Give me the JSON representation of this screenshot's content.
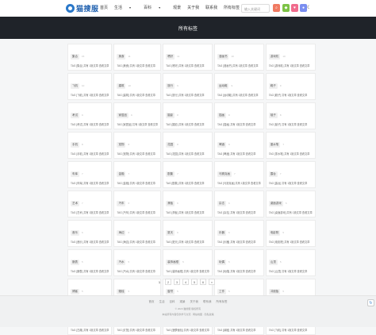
{
  "header": {
    "logo_text": "猫搜服",
    "nav": [
      "首页",
      "生活",
      "百科",
      "观景",
      "关于我",
      "联系我",
      "所有标签"
    ],
    "search_placeholder": "输入关键词",
    "search_icon": "search-icon",
    "moon_icon": "moon-icon"
  },
  "banner": {
    "title": "所有标签"
  },
  "tags": [
    {
      "name": "集合",
      "count": "15",
      "desc": "TAG [集合] 共有 1篇文章 查看文章"
    },
    {
      "name": "美食",
      "count": "11",
      "desc": "TAG [美食] 共有 1篇文章 查看文章"
    },
    {
      "name": "嗜好",
      "count": "11",
      "desc": "TAG [嗜好] 共有 1篇文章 查看文章"
    },
    {
      "name": "漫画书",
      "count": "10",
      "desc": "TAG [漫画书] 共有 1篇文章 查看文章"
    },
    {
      "name": "游戏机",
      "count": "10",
      "desc": "TAG [游戏机] 共有 1篇文章 查看文章"
    },
    {
      "name": "飞机",
      "count": "10",
      "desc": "TAG [飞机] 共有 1篇文章 查看文章"
    },
    {
      "name": "建筑",
      "count": "10",
      "desc": "TAG [建筑] 共有 1篇文章 查看文章"
    },
    {
      "name": "旅行",
      "count": "9",
      "desc": "TAG [旅行] 共有 1篇文章 查看文章"
    },
    {
      "name": "运动鞋",
      "count": "9",
      "desc": "TAG [运动鞋] 共有 1篇文章 查看文章"
    },
    {
      "name": "鞋子",
      "count": "9",
      "desc": "TAG [鞋子] 共有 1篇文章 查看文章"
    },
    {
      "name": "考试",
      "count": "9",
      "desc": "TAG [考试] 共有 1篇文章 查看文章"
    },
    {
      "name": "家居品",
      "count": "9",
      "desc": "TAG [家居品] 共有 1篇文章 查看文章"
    },
    {
      "name": "摄影",
      "count": "8",
      "desc": "TAG [摄影] 共有 1篇文章 查看文章"
    },
    {
      "name": "插画",
      "count": "8",
      "desc": "TAG [插画] 共有 1篇文章 查看文章"
    },
    {
      "name": "毯子",
      "count": "8",
      "desc": "TAG [毯子] 共有 1篇文章 查看文章"
    },
    {
      "name": "手机",
      "count": "8",
      "desc": "TAG [手机] 共有 1篇文章 查看文章"
    },
    {
      "name": "宠物",
      "count": "8",
      "desc": "TAG [宠物] 共有 1篇文章 查看文章"
    },
    {
      "name": "花园",
      "count": "8",
      "desc": "TAG [花园] 共有 1篇文章 查看文章"
    },
    {
      "name": "啤酒",
      "count": "8",
      "desc": "TAG [啤酒] 共有 1篇文章 查看文章"
    },
    {
      "name": "墨水笔",
      "count": "7",
      "desc": "TAG [墨水笔] 共有 1篇文章 查看文章"
    },
    {
      "name": "车库",
      "count": "7",
      "desc": "TAG [车库] 共有 1篇文章 查看文章"
    },
    {
      "name": "金融",
      "count": "7",
      "desc": "TAG [金融] 共有 1篇文章 查看文章"
    },
    {
      "name": "剧集",
      "count": "7",
      "desc": "TAG [剧集] 共有 1篇文章 查看文章"
    },
    {
      "name": "马赛克画",
      "count": "7",
      "desc": "TAG [马赛克画] 共有 1篇文章 查看文章"
    },
    {
      "name": "露台",
      "count": "7",
      "desc": "TAG [露台] 共有 1篇文章 查看文章"
    },
    {
      "name": "艺术",
      "count": "7",
      "desc": "TAG [艺术] 共有 1篇文章 查看文章"
    },
    {
      "name": "汽车",
      "count": "6",
      "desc": "TAG [汽车] 共有 1篇文章 查看文章"
    },
    {
      "name": "滑板",
      "count": "6",
      "desc": "TAG [滑板] 共有 1篇文章 查看文章"
    },
    {
      "name": "杂志",
      "count": "6",
      "desc": "TAG [杂志] 共有 1篇文章 查看文章"
    },
    {
      "name": "桌面游戏",
      "count": "6",
      "desc": "TAG [桌面游戏] 共有 1篇文章 查看文章"
    },
    {
      "name": "音乐",
      "count": "6",
      "desc": "TAG [音乐] 共有 1篇文章 查看文章"
    },
    {
      "name": "海边",
      "count": "6",
      "desc": "TAG [海边] 共有 1篇文章 查看文章"
    },
    {
      "name": "夏天",
      "count": "6",
      "desc": "TAG [夏天] 共有 1篇文章 查看文章"
    },
    {
      "name": "乐器",
      "count": "6",
      "desc": "TAG [乐器] 共有 1篇文章 查看文章"
    },
    {
      "name": "电影院",
      "count": "5",
      "desc": "TAG [电影院] 共有 1篇文章 查看文章"
    },
    {
      "name": "腕表",
      "count": "5",
      "desc": "TAG [腕表] 共有 1篇文章 查看文章"
    },
    {
      "name": "汽水",
      "count": "5",
      "desc": "TAG [汽水] 共有 1篇文章 查看文章"
    },
    {
      "name": "装饰画框",
      "count": "5",
      "desc": "TAG [装饰画框] 共有 1篇文章 查看文章"
    },
    {
      "name": "玩偶",
      "count": "5",
      "desc": "TAG [玩偶] 共有 1篇文章 查看文章"
    },
    {
      "name": "山顶",
      "count": "5",
      "desc": "TAG [山顶] 共有 1篇文章 查看文章"
    },
    {
      "name": "博客",
      "count": "5",
      "desc": "TAG [博客] 共有 1篇文章 查看文章"
    },
    {
      "name": "蜡烛",
      "count": "5",
      "desc": "TAG [蜡烛] 共有 1篇文章 查看文章"
    },
    {
      "name": "窗帘",
      "count": "5",
      "desc": "TAG [窗帘] 共有 1篇文章 查看文章"
    },
    {
      "name": "工作",
      "count": "5",
      "desc": "TAG [工作] 共有 1篇文章 查看文章"
    },
    {
      "name": "冲浪板",
      "count": "5",
      "desc": "TAG [冲浪板] 共有 1篇文章 查看文章"
    },
    {
      "name": "古典",
      "count": "4",
      "desc": "TAG [古典] 共有 1篇文章 查看文章"
    },
    {
      "name": "灯笼",
      "count": "4",
      "desc": "TAG [灯笼] 共有 1篇文章 查看文章"
    },
    {
      "name": "菠萝面包",
      "count": "4",
      "desc": "TAG [菠萝面包] 共有 1篇文章 查看文章"
    },
    {
      "name": "绿植",
      "count": "4",
      "desc": "TAG [绿植] 共有 1篇文章 查看文章"
    },
    {
      "name": "飞机",
      "count": "4",
      "desc": "TAG [飞机] 共有 1篇文章 查看文章"
    }
  ],
  "pagination": [
    "1",
    "2",
    "3",
    "4",
    "5",
    "6",
    "»"
  ],
  "footer": {
    "links": [
      "首页",
      "生活",
      "百科",
      "观景",
      "关于我",
      "联系我",
      "所有标签"
    ],
    "line1": "© 2023 猫搜服 版权所有",
    "line2": "本站所有内容仅供学习交流 · 网站地图 · 隐私政策"
  }
}
